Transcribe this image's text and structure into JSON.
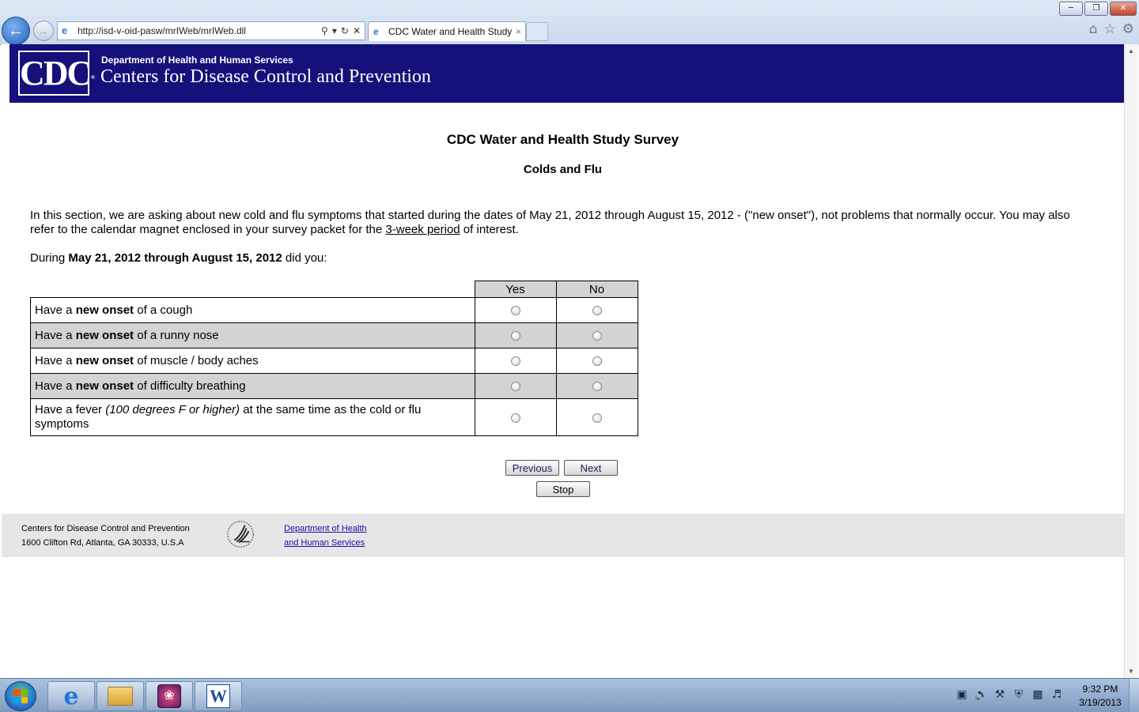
{
  "browser": {
    "url": "http://isd-v-oid-pasw/mrIWeb/mrIWeb.dll",
    "tab_title": "CDC Water and Health Study",
    "tab_close": "×",
    "window_buttons": {
      "minimize": "─",
      "restore": "❐",
      "close": "✕"
    }
  },
  "banner": {
    "logo_text": "CDC",
    "logo_registered": "®",
    "department": "Department of Health and Human Services",
    "agency": "Centers for Disease Control and Prevention"
  },
  "survey": {
    "title": "CDC Water and Health Study Survey",
    "section": "Colds and Flu",
    "intro_part1": "In this section, we are asking about new cold and flu symptoms that started during the dates of May 21, 2012 through August 15, 2012 - (\"new onset\"), not problems that normally occur. You may also refer to the calendar magnet enclosed in your survey packet for the ",
    "intro_link": "3-week period",
    "intro_part2": " of interest.",
    "question_prefix": "During ",
    "question_dates": "May 21, 2012 through August 15, 2012",
    "question_suffix": " did you:",
    "columns": [
      "Yes",
      "No"
    ],
    "rows": [
      {
        "prefix": "Have a ",
        "bold": "new onset",
        "suffix": " of a cough"
      },
      {
        "prefix": "Have a ",
        "bold": "new onset",
        "suffix": " of a runny nose"
      },
      {
        "prefix": "Have a ",
        "bold": "new onset",
        "suffix": " of muscle / body aches"
      },
      {
        "prefix": "Have a ",
        "bold": "new onset",
        "suffix": " of difficulty breathing"
      },
      {
        "prefix": "Have a fever ",
        "italic": "(100 degrees F or higher)",
        "suffix": " at the same time as the cold or flu symptoms"
      }
    ],
    "buttons": {
      "previous": "Previous",
      "next": "Next",
      "stop": "Stop"
    }
  },
  "footer": {
    "org_name": "Centers for Disease Control and Prevention",
    "address": "1600 Clifton Rd, Atlanta, GA 30333, U.S.A",
    "hhs_link_line1": "Department of Health",
    "hhs_link_line2": "and Human Services"
  },
  "taskbar": {
    "clock_time": "9:32 PM",
    "clock_date": "3/19/2013",
    "word_icon_letter": "W"
  },
  "colors": {
    "banner_bg": "#15117a",
    "table_shade": "#d3d3d3",
    "footer_bg": "#e6e6e6",
    "link": "#1a0dab"
  }
}
